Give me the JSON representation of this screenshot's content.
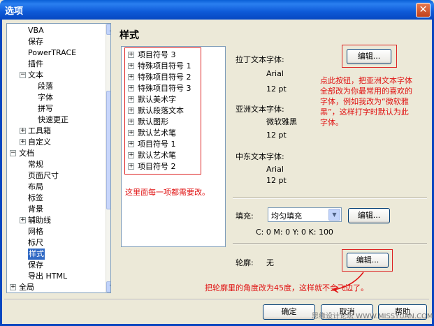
{
  "window": {
    "title": "选项",
    "close_label": "✕"
  },
  "tree": {
    "items": [
      {
        "label": "VBA",
        "level": 2,
        "expander": ""
      },
      {
        "label": "保存",
        "level": 2,
        "expander": ""
      },
      {
        "label": "PowerTRACE",
        "level": 2,
        "expander": ""
      },
      {
        "label": "插件",
        "level": 2,
        "expander": ""
      },
      {
        "label": "文本",
        "level": 2,
        "expander": "−"
      },
      {
        "label": "段落",
        "level": 3,
        "expander": ""
      },
      {
        "label": "字体",
        "level": 3,
        "expander": ""
      },
      {
        "label": "拼写",
        "level": 3,
        "expander": ""
      },
      {
        "label": "快速更正",
        "level": 3,
        "expander": ""
      },
      {
        "label": "工具箱",
        "level": 2,
        "expander": "+"
      },
      {
        "label": "自定义",
        "level": 2,
        "expander": "+"
      },
      {
        "label": "文档",
        "level": 1,
        "expander": "−"
      },
      {
        "label": "常规",
        "level": 2,
        "expander": ""
      },
      {
        "label": "页面尺寸",
        "level": 2,
        "expander": ""
      },
      {
        "label": "布局",
        "level": 2,
        "expander": ""
      },
      {
        "label": "标签",
        "level": 2,
        "expander": ""
      },
      {
        "label": "背景",
        "level": 2,
        "expander": ""
      },
      {
        "label": "辅助线",
        "level": 2,
        "expander": "+"
      },
      {
        "label": "网格",
        "level": 2,
        "expander": ""
      },
      {
        "label": "标尺",
        "level": 2,
        "expander": ""
      },
      {
        "label": "样式",
        "level": 2,
        "expander": "",
        "selected": true
      },
      {
        "label": "保存",
        "level": 2,
        "expander": ""
      },
      {
        "label": "导出 HTML",
        "level": 2,
        "expander": ""
      },
      {
        "label": "全局",
        "level": 1,
        "expander": "+"
      }
    ]
  },
  "panel": {
    "heading": "样式",
    "styles": [
      "项目符号 3",
      "特殊项目符号 1",
      "特殊项目符号 2",
      "特殊项目符号 3",
      "默认美术字",
      "默认段落文本",
      "默认图形",
      "默认艺术笔",
      "项目符号 1",
      "默认艺术笔",
      "项目符号 2"
    ],
    "latin_font_label": "拉丁文本字体:",
    "latin_font_name": "Arial",
    "latin_font_size": "12 pt",
    "asian_font_label": "亚洲文本字体:",
    "asian_font_name": "微软雅黑",
    "asian_font_size": "12 pt",
    "me_font_label": "中东文本字体:",
    "me_font_name": "Arial",
    "me_font_size": "12 pt",
    "edit_label": "编辑...",
    "fill_label": "填充:",
    "fill_value": "均匀填充",
    "fill_cmyk": "C: 0 M: 0 Y: 0 K: 100",
    "outline_label": "轮廓:",
    "outline_value": "无"
  },
  "annotations": {
    "list_note": "这里面每一项都需要改。",
    "edit_note": [
      "点此按钮，把亚洲文本字体",
      "全部改为你最常用的喜欢的",
      "字体，例如我改为“微软雅",
      "黑”，这样打字时默认为此",
      "字体。"
    ],
    "outline_note": "把轮廓里的角度改为45度，这样就不会飞边了。"
  },
  "footer": {
    "ok": "确定",
    "cancel": "取消",
    "help": "帮助",
    "watermark": "思缘设计论坛  WWW.MISSYUAN.COM"
  },
  "colors": {
    "titlebar": "#0a5fd6",
    "selection": "#316ac5",
    "annotation": "#e01010",
    "dialog_bg": "#ece9d8"
  }
}
